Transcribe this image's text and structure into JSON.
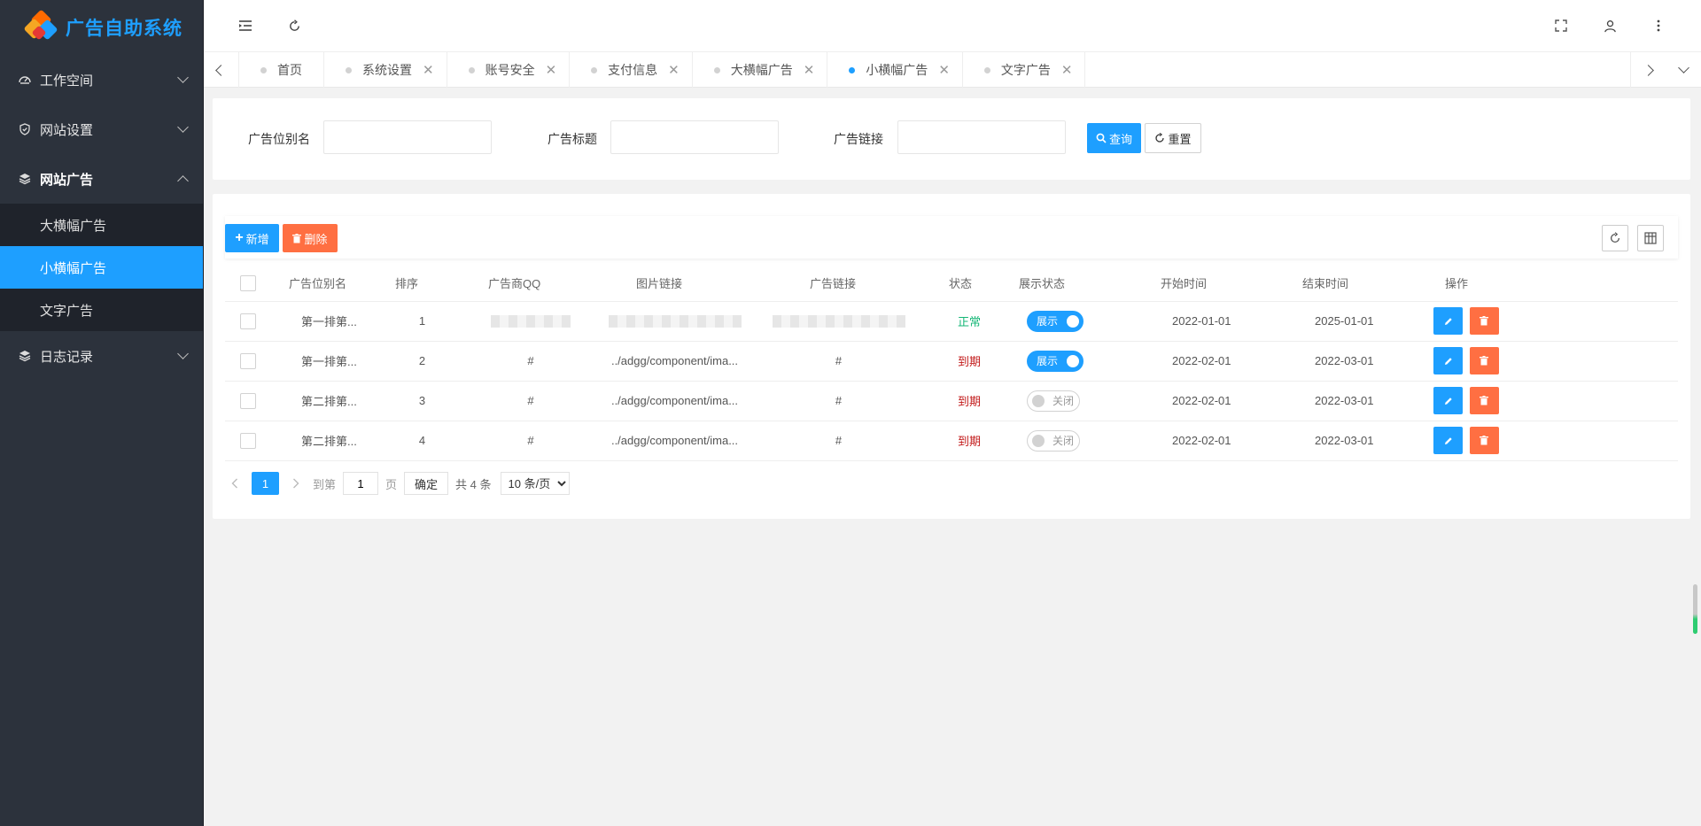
{
  "app": {
    "title": "广告自助系统"
  },
  "sidebar": {
    "items": [
      {
        "label": "工作空间",
        "icon": "dashboard-icon"
      },
      {
        "label": "网站设置",
        "icon": "shield-icon"
      },
      {
        "label": "网站广告",
        "icon": "layers-icon",
        "open": true,
        "children": [
          {
            "label": "大横幅广告"
          },
          {
            "label": "小横幅广告",
            "active": true
          },
          {
            "label": "文字广告"
          }
        ]
      },
      {
        "label": "日志记录",
        "icon": "layers-icon"
      }
    ]
  },
  "tabs": [
    {
      "label": "首页"
    },
    {
      "label": "系统设置"
    },
    {
      "label": "账号安全"
    },
    {
      "label": "支付信息"
    },
    {
      "label": "大横幅广告"
    },
    {
      "label": "小横幅广告",
      "active": true
    },
    {
      "label": "文字广告"
    }
  ],
  "search": {
    "fields": [
      {
        "label": "广告位别名",
        "value": ""
      },
      {
        "label": "广告标题",
        "value": ""
      },
      {
        "label": "广告链接",
        "value": ""
      }
    ],
    "query_label": "查询",
    "reset_label": "重置"
  },
  "toolbar": {
    "add_label": "新增",
    "delete_label": "删除"
  },
  "table": {
    "headers": [
      "广告位别名",
      "排序",
      "广告商QQ",
      "图片链接",
      "广告链接",
      "状态",
      "展示状态",
      "开始时间",
      "结束时间",
      "操作"
    ],
    "rows": [
      {
        "alias": "第一排第...",
        "order": "1",
        "qq": "",
        "img": "",
        "link": "",
        "status": "正常",
        "status_type": "ok",
        "display": "展示",
        "display_on": true,
        "start": "2022-01-01",
        "end": "2025-01-01"
      },
      {
        "alias": "第一排第...",
        "order": "2",
        "qq": "#",
        "img": "../adgg/component/ima...",
        "link": "#",
        "status": "到期",
        "status_type": "expired",
        "display": "展示",
        "display_on": true,
        "start": "2022-02-01",
        "end": "2022-03-01"
      },
      {
        "alias": "第二排第...",
        "order": "3",
        "qq": "#",
        "img": "../adgg/component/ima...",
        "link": "#",
        "status": "到期",
        "status_type": "expired",
        "display": "关闭",
        "display_on": false,
        "start": "2022-02-01",
        "end": "2022-03-01"
      },
      {
        "alias": "第二排第...",
        "order": "4",
        "qq": "#",
        "img": "../adgg/component/ima...",
        "link": "#",
        "status": "到期",
        "status_type": "expired",
        "display": "关闭",
        "display_on": false,
        "start": "2022-02-01",
        "end": "2022-03-01"
      }
    ]
  },
  "pager": {
    "current": "1",
    "goto_label": "到第",
    "goto_value": "1",
    "page_unit": "页",
    "confirm_label": "确定",
    "total_label": "共 4 条",
    "per_page_selected": "10 条/页"
  },
  "colors": {
    "primary": "#1e9fff",
    "danger": "#ff5722",
    "sidebar_bg": "#2c323c",
    "ok": "#16b777",
    "expired": "#c21a1a"
  }
}
